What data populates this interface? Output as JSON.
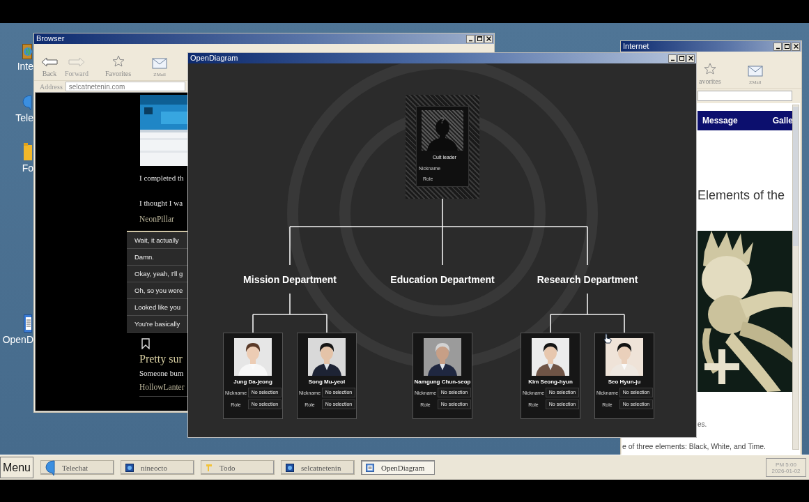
{
  "desktop_icons": [
    {
      "kind": "globe",
      "label": "Inte"
    },
    {
      "kind": "chat",
      "label": "Tele"
    },
    {
      "kind": "folder",
      "label": "Fo"
    },
    {
      "kind": "document",
      "label": "OpenD"
    }
  ],
  "browser": {
    "title": "Browser",
    "toolbar": [
      {
        "kind": "back",
        "label": "Back",
        "disabled": false
      },
      {
        "kind": "forward",
        "label": "Forward",
        "disabled": true
      },
      {
        "kind": "favorites",
        "label": "Favorites",
        "disabled": false
      },
      {
        "kind": "mail",
        "label": "ZMail",
        "disabled": false
      }
    ],
    "address_label": "Address",
    "address": "selcatnetenin.com",
    "post": {
      "paragraphs": [
        "I completed th",
        "I thought I wa"
      ],
      "author": "NeonPillar"
    },
    "comments": [
      "Wait, it actually",
      "Damn.",
      "Okay, yeah, I'll g",
      "Oh, so you were",
      "Looked like you",
      "You're basically"
    ],
    "next_post": {
      "title": "Pretty sur",
      "text": "Someone bum",
      "author": "HollowLanter"
    }
  },
  "internet": {
    "title": "Internet",
    "toolbar": [
      {
        "kind": "favorites",
        "label": "avorites",
        "disabled": false
      },
      {
        "kind": "mail",
        "label": "ZMail",
        "disabled": false
      }
    ],
    "nav": [
      "Message",
      "Galle"
    ],
    "heading": "Elements of the",
    "caption_tail": "es.",
    "footer_text": "e of three elements: Black, White, and Time."
  },
  "diagram": {
    "title": "OpenDiagram",
    "root": {
      "mark": "?",
      "title": "Cult leader",
      "fields": [
        "Nickname",
        "Role"
      ]
    },
    "departments": [
      {
        "name": "Mission Department",
        "members": [
          {
            "name": "Jung Da-jeong",
            "fields": [
              {
                "label": "Nickname",
                "value": "No selection"
              },
              {
                "label": "Role",
                "value": "No selection"
              }
            ]
          },
          {
            "name": "Song Mu-yeol",
            "fields": [
              {
                "label": "Nickname",
                "value": "No selection"
              },
              {
                "label": "Role",
                "value": "No selection"
              }
            ]
          }
        ]
      },
      {
        "name": "Education Department",
        "members": [
          {
            "name": "Namgung Chun-seop",
            "fields": [
              {
                "label": "Nickname",
                "value": "No selection"
              },
              {
                "label": "Role",
                "value": "No selection"
              }
            ]
          }
        ]
      },
      {
        "name": "Research Department",
        "members": [
          {
            "name": "Kim Seong-hyun",
            "fields": [
              {
                "label": "Nickname",
                "value": "No selection"
              },
              {
                "label": "Role",
                "value": "No selection"
              }
            ]
          },
          {
            "name": "Seo Hyun-ju",
            "fields": [
              {
                "label": "Nickname",
                "value": "No selection"
              },
              {
                "label": "Role",
                "value": "No selection"
              }
            ]
          }
        ]
      }
    ]
  },
  "taskbar": {
    "menu": "Menu",
    "tasks": [
      {
        "kind": "chat",
        "label": "Telechat",
        "selected": false
      },
      {
        "kind": "site",
        "label": "nineocto",
        "selected": false
      },
      {
        "kind": "note",
        "label": "Todo",
        "selected": false
      },
      {
        "kind": "site",
        "label": "selcatnetenin",
        "selected": false
      },
      {
        "kind": "diagram",
        "label": "OpenDiagram",
        "selected": true
      }
    ],
    "clock": {
      "time": "PM 5:00",
      "date": "2026-01-02"
    }
  }
}
